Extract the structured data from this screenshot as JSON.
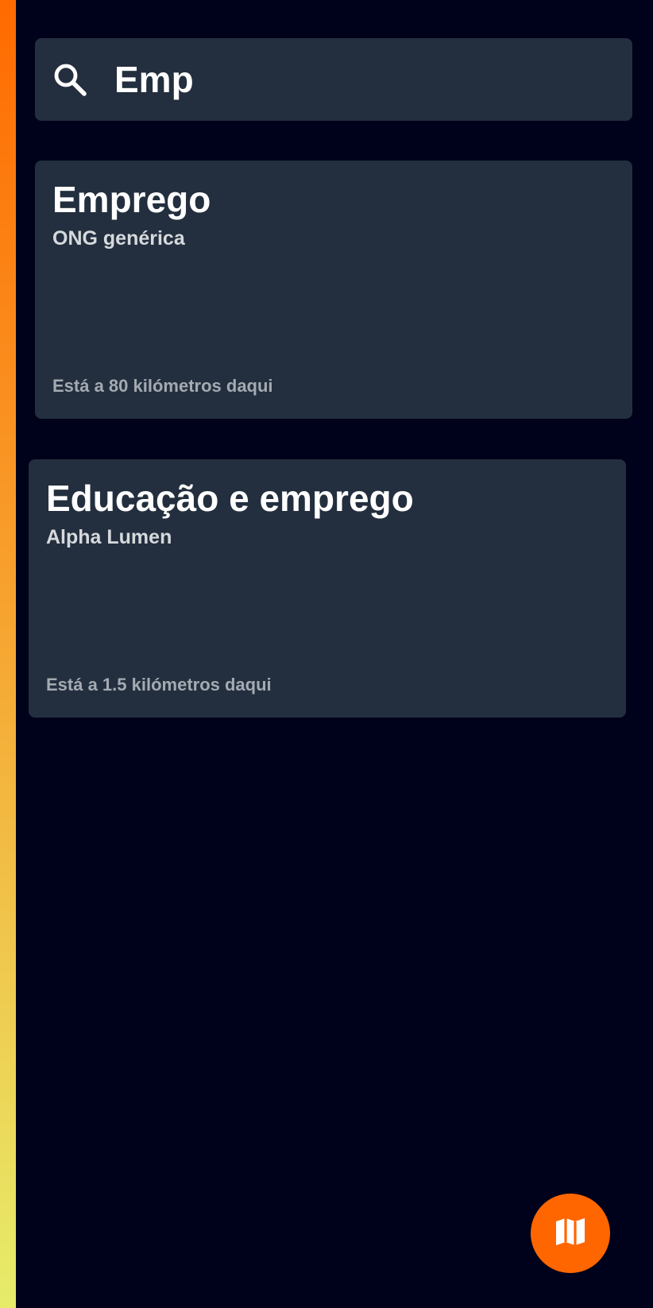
{
  "accent_color": "#ff6600",
  "search": {
    "value": "Emp",
    "icon": "search-icon"
  },
  "results": [
    {
      "title": "Emprego",
      "organization": "ONG genérica",
      "distance": "Está a 80 kilómetros daqui"
    },
    {
      "title": "Educação e emprego",
      "organization": "Alpha Lumen",
      "distance": "Está a 1.5 kilómetros daqui"
    }
  ],
  "fab": {
    "icon": "map-icon"
  }
}
